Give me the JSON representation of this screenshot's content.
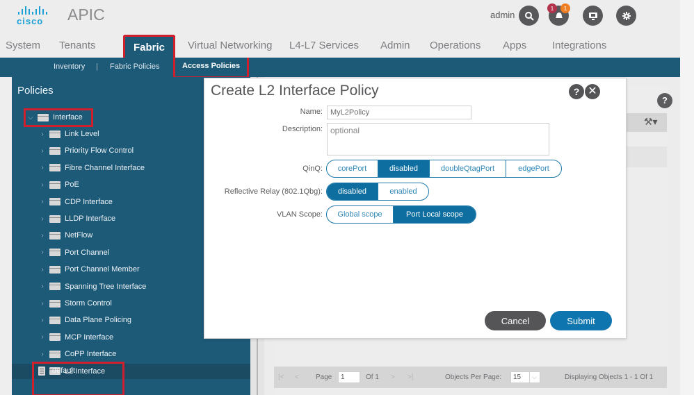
{
  "header": {
    "logo_text": "cisco",
    "app_title": "APIC",
    "user": "admin",
    "icons": [
      "search-icon",
      "alerts-icon",
      "screen-icon",
      "settings-icon"
    ],
    "alert_badges": [
      "1",
      "1"
    ]
  },
  "main_tabs": [
    {
      "label": "System"
    },
    {
      "label": "Tenants"
    },
    {
      "label": "Fabric",
      "active": true
    },
    {
      "label": "Virtual Networking"
    },
    {
      "label": "L4-L7 Services"
    },
    {
      "label": "Admin"
    },
    {
      "label": "Operations"
    },
    {
      "label": "Apps"
    },
    {
      "label": "Integrations"
    }
  ],
  "sub_tabs": [
    {
      "label": "Inventory"
    },
    {
      "label": "Fabric Policies"
    },
    {
      "label": "Access Policies",
      "active": true
    }
  ],
  "sub_separator": "|",
  "sidebar": {
    "title": "Policies",
    "root": "Interface",
    "items": [
      "Link Level",
      "Priority Flow Control",
      "Fibre Channel Interface",
      "PoE",
      "CDP Interface",
      "LLDP Interface",
      "NetFlow",
      "Port Channel",
      "Port Channel Member",
      "Spanning Tree Interface",
      "Storm Control",
      "Data Plane Policing",
      "MCP Interface",
      "CoPP Interface",
      "L2 Interface"
    ],
    "child": "default"
  },
  "modal": {
    "title": "Create L2 Interface Policy",
    "help": "?",
    "close": "✕",
    "name_label": "Name:",
    "name_value": "MyL2Policy",
    "description_label": "Description:",
    "description_placeholder": "optional",
    "qinq_label": "QinQ:",
    "qinq_options": [
      "corePort",
      "disabled",
      "doubleQtagPort",
      "edgePort"
    ],
    "qinq_selected": "disabled",
    "relay_label": "Reflective Relay (802.1Qbg):",
    "relay_options": [
      "disabled",
      "enabled"
    ],
    "relay_selected": "disabled",
    "vlan_label": "VLAN Scope:",
    "vlan_options": [
      "Global scope",
      "Port Local scope"
    ],
    "vlan_selected": "Port Local scope",
    "cancel": "Cancel",
    "submit": "Submit"
  },
  "content": {
    "help": "?",
    "pager": {
      "first": "|<",
      "prev": "<",
      "page_label": "Page",
      "page_value": "1",
      "of_label": "Of 1",
      "next": ">",
      "last": ">|",
      "per_page_label": "Objects Per Page:",
      "per_page_value": "15",
      "display_text": "Displaying Objects 1 - 1 Of 1"
    }
  }
}
